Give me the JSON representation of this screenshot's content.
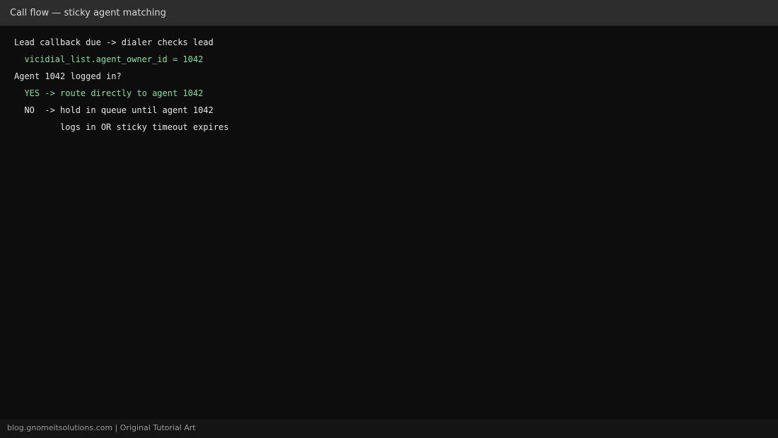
{
  "window": {
    "title": "Call flow — sticky agent matching"
  },
  "content": {
    "lines": [
      {
        "text": "Lead callback due -> dialer checks lead",
        "color": "#e6e6e6"
      },
      {
        "text": "  vicidial_list.agent_owner_id = 1042",
        "color": "#7ee0a0"
      },
      {
        "text": "Agent 1042 logged in?",
        "color": "#e6e6e6"
      },
      {
        "text": "  YES -> route directly to agent 1042",
        "color": "#7ee0a0"
      },
      {
        "text": "  NO  -> hold in queue until agent 1042",
        "color": "#e6e6e6"
      },
      {
        "text": "         logs in OR sticky timeout expires",
        "color": "#e6e6e6"
      }
    ]
  },
  "footer": {
    "credit": "blog.gnomeitsolutions.com | Original Tutorial Art"
  }
}
